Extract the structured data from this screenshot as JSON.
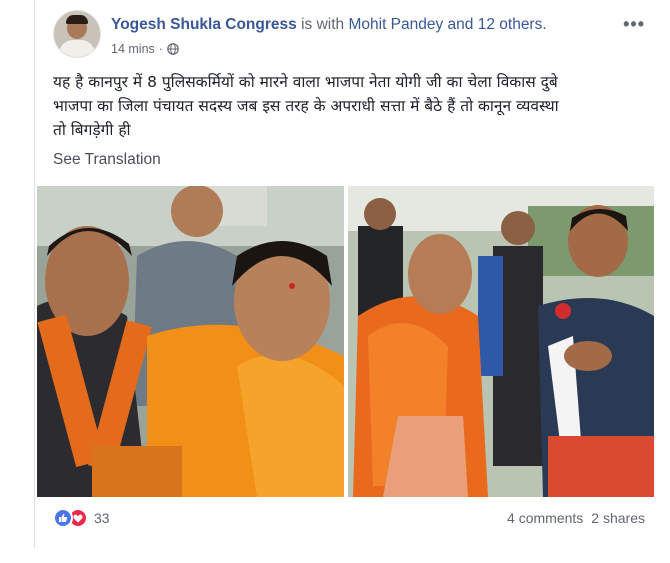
{
  "post": {
    "author": "Yogesh Shukla Congress",
    "with_prefix": "is with",
    "with_names": "Mohit Pandey and 12 others.",
    "time": "14 mins",
    "separator": "·",
    "more_icon": "more-options-icon",
    "text_line1": "यह है कानपुर में 8 पुलिसकर्मियों को मारने वाला भाजपा नेता योगी जी का चेला विकास दुबे",
    "text_line2": "भाजपा का जिला पंचायत सदस्य जब इस तरह के अपराधी सत्ता में बैठे हैं तो कानून व्यवस्था",
    "text_line3": "तो बिगड़ेगी ही",
    "see_translation": "See Translation"
  },
  "photos": [
    "photo-left-politicians",
    "photo-right-politicians"
  ],
  "footer": {
    "reaction_count": "33",
    "comments": "4 comments",
    "shares": "2 shares"
  },
  "colors": {
    "link_blue": "#385898",
    "like_blue": "#4a76e8",
    "love_red": "#f0284a",
    "meta_gray": "#606770"
  }
}
